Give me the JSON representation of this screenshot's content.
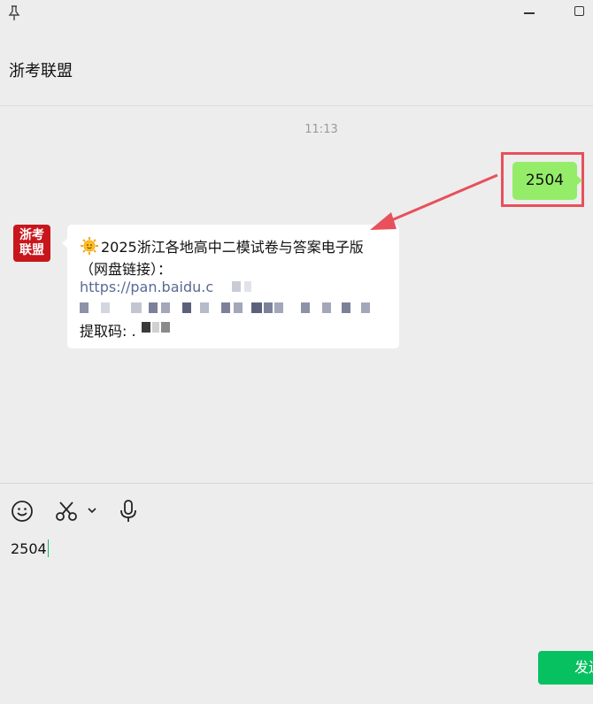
{
  "chat": {
    "title": "浙考联盟"
  },
  "timestamp": "11:13",
  "sent_message": {
    "text": "2504"
  },
  "received_message": {
    "avatar_line1": "浙考",
    "avatar_line2": "联盟",
    "title": "2025浙江各地高中二模试卷与答案电子版",
    "subtitle": "（网盘链接）：",
    "link_prefix": "https://pan.baidu.c",
    "code_label": "提取码: ."
  },
  "input": {
    "value": "2504"
  },
  "send_button": {
    "label": "发送"
  },
  "colors": {
    "sent_bubble": "#95ec69",
    "send_button": "#07c160",
    "annotation": "#e8505b",
    "link": "#576b95"
  },
  "icons": [
    "pin-icon",
    "minimize-icon",
    "maximize-icon",
    "emoji-icon",
    "scissors-icon",
    "chevron-down-icon",
    "microphone-icon",
    "sun-emoji-icon"
  ]
}
